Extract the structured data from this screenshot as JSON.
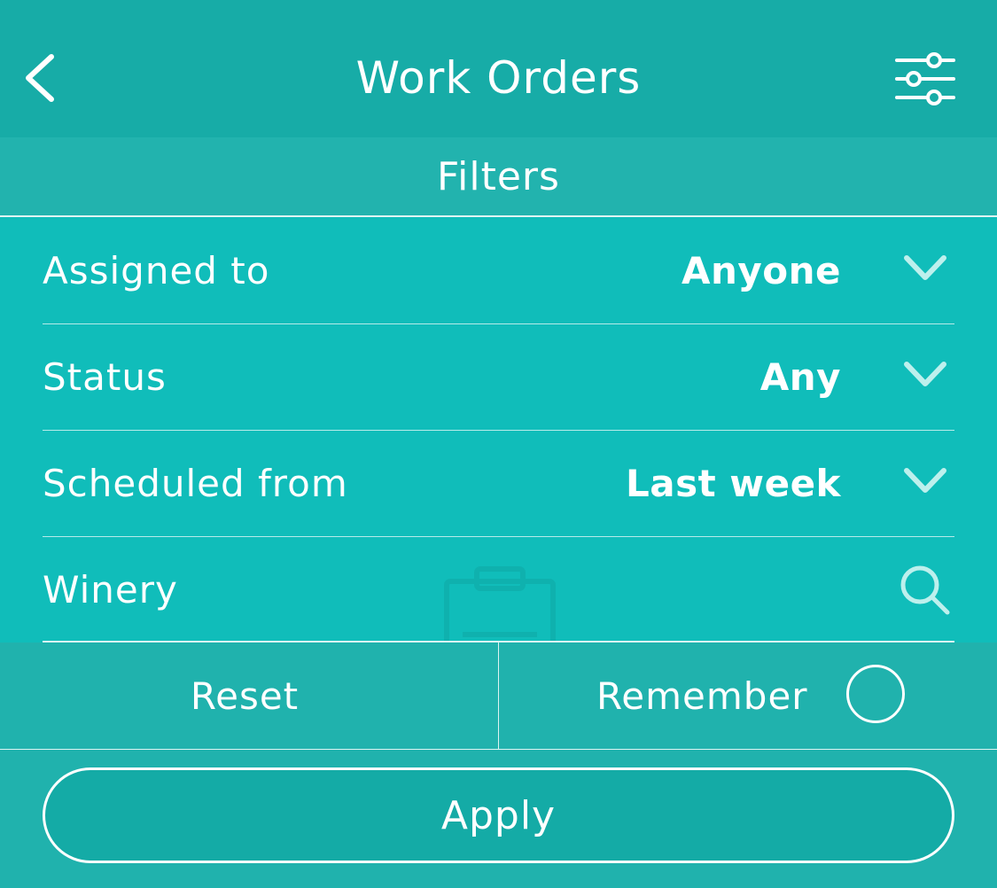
{
  "header": {
    "title": "Work Orders",
    "back_icon": "chevron-left-icon",
    "filter_icon": "sliders-icon"
  },
  "filters": {
    "heading": "Filters",
    "rows": [
      {
        "label": "Assigned to",
        "value": "Anyone",
        "icon": "chevron-down-icon"
      },
      {
        "label": "Status",
        "value": "Any",
        "icon": "chevron-down-icon"
      },
      {
        "label": "Scheduled from",
        "value": "Last week",
        "icon": "chevron-down-icon"
      },
      {
        "label": "Winery",
        "icon": "search-icon"
      }
    ],
    "reset_label": "Reset",
    "remember_label": "Remember",
    "remember_checked": false,
    "apply_label": "Apply"
  },
  "colors": {
    "header": "#17aca7",
    "panel": "#10bdba",
    "background": "#20b2ad",
    "chevron": "#bdf0ed"
  }
}
